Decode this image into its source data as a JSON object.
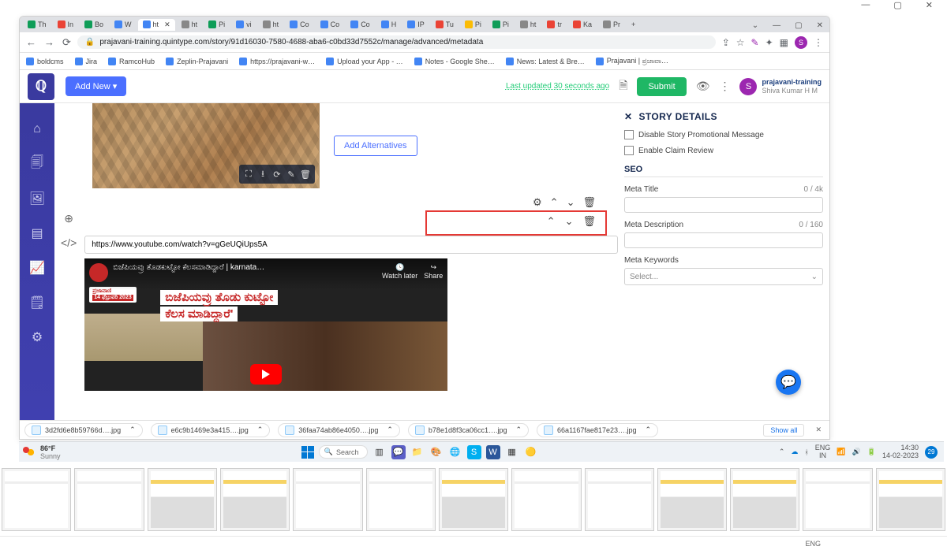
{
  "outerWindow": {
    "min": "—",
    "max": "▢",
    "close": "✕"
  },
  "browserWin": {
    "chevron": "⌄",
    "min": "—",
    "max": "▢",
    "close": "✕"
  },
  "tabs": [
    {
      "fav": "g",
      "label": "Th"
    },
    {
      "fav": "r",
      "label": "In"
    },
    {
      "fav": "g",
      "label": "Bo"
    },
    {
      "fav": "b",
      "label": "W"
    },
    {
      "fav": "b",
      "label": "ht",
      "active": true
    },
    {
      "fav": "gr",
      "label": "ht"
    },
    {
      "fav": "g",
      "label": "Pi"
    },
    {
      "fav": "b",
      "label": "vi"
    },
    {
      "fav": "gr",
      "label": "ht"
    },
    {
      "fav": "b",
      "label": "Co"
    },
    {
      "fav": "b",
      "label": "Co"
    },
    {
      "fav": "b",
      "label": "Co"
    },
    {
      "fav": "b",
      "label": "H"
    },
    {
      "fav": "b",
      "label": "IP"
    },
    {
      "fav": "r",
      "label": "Tu"
    },
    {
      "fav": "y",
      "label": "Pi"
    },
    {
      "fav": "g",
      "label": "Pi"
    },
    {
      "fav": "gr",
      "label": "ht"
    },
    {
      "fav": "r",
      "label": "tr"
    },
    {
      "fav": "r",
      "label": "Ka"
    },
    {
      "fav": "gr",
      "label": "Pr"
    }
  ],
  "addressBar": {
    "lock": "🔒",
    "url": "prajavani-training.quintype.com/story/91d16030-7580-4688-aba6-c0bd33d7552c/manage/advanced/metadata",
    "profileLetter": "S"
  },
  "bookmarks": [
    "boldcms",
    "Jira",
    "RamcoHub",
    "Zeplin-Prajavani",
    "https://prajavani-w…",
    "Upload your App - …",
    "Notes - Google She…",
    "News: Latest & Bre…",
    "Prajavani | ಪ್ರಜಾವಾ…"
  ],
  "topbar": {
    "addNew": "Add New ▾",
    "lastUpdated": "Last updated 30 seconds ago",
    "submit": "Submit",
    "user": {
      "initial": "S",
      "name": "prajavani-training",
      "sub": "Shiva Kumar H M"
    }
  },
  "hero": {
    "toolbar": [
      "⛶",
      "⭳",
      "⟳",
      "✎",
      "🗑"
    ],
    "addAlternatives": "Add Alternatives"
  },
  "embed": {
    "url": "https://www.youtube.com/watch?v=gGeUQiUps5A",
    "videoTitle": "ಬಿಜೆಪಿಯವ್ರು ತೊಡಕುಟ್ಟೋ ಕೆಲಸಮಾಡಿದ್ದಾರೆ | karnata…",
    "watchLater": "Watch later",
    "share": "Share",
    "stampTop": "ಪ್ರಜಾವಾಣಿ",
    "stampDate": "14 ಫೆಬ್ರುವರಿ 2023",
    "bannerLine1": "ಬಿಜೆಪಿಯವ್ರು ತೊಡು ಕುಟ್ಟೋ",
    "bannerLine2": "ಕೆಲಸ ಮಾಡಿದ್ದಾರೆ'"
  },
  "storyDetails": {
    "heading": "STORY DETAILS",
    "disablePromo": "Disable Story Promotional Message",
    "enableClaim": "Enable Claim Review",
    "seo": "SEO",
    "metaTitle": "Meta Title",
    "metaTitleCount": "0 / 4k",
    "metaDesc": "Meta Description",
    "metaDescCount": "0 / 160",
    "metaKeywords": "Meta Keywords",
    "selectPh": "Select..."
  },
  "downloads": {
    "items": [
      "3d2fd6e8b59766d….jpg",
      "e6c9b1469e3a415….jpg",
      "36faa74ab86e4050….jpg",
      "b78e1d8f3ca06cc1….jpg",
      "66a1167fae817e23….jpg"
    ],
    "showAll": "Show all"
  },
  "taskbar": {
    "temp": "86°F",
    "cond": "Sunny",
    "search": "Search",
    "lang1": "ENG",
    "lang2": "IN",
    "time": "14:30",
    "date": "14-02-2023",
    "notif": "29",
    "bottomLang": "ENG"
  }
}
